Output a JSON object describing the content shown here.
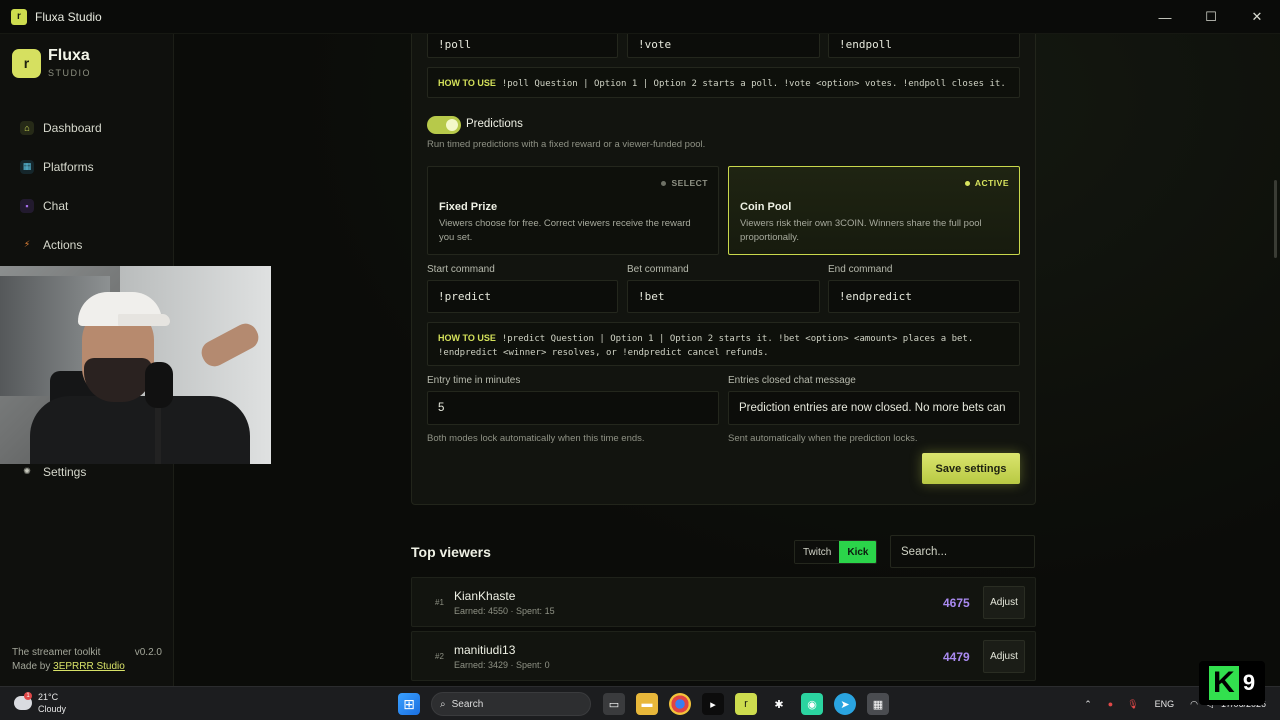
{
  "window": {
    "title": "Fluxa Studio",
    "controls": {
      "minimize": "—",
      "maximize": "☐",
      "close": "✕"
    }
  },
  "sidebar": {
    "brand_name": "Fluxa",
    "brand_sub": "STUDIO",
    "items": [
      {
        "label": "Dashboard",
        "icon": "home-icon",
        "color": "#d4e15a"
      },
      {
        "label": "Platforms",
        "icon": "grid-icon",
        "color": "#5ec8e8"
      },
      {
        "label": "Chat",
        "icon": "chat-icon",
        "color": "#a46de8"
      },
      {
        "label": "Actions",
        "icon": "bolt-icon",
        "color": "#f08a3a"
      }
    ],
    "settings_label": "Settings",
    "footer_tagline": "The streamer toolkit",
    "version": "v0.2.0",
    "made_by_prefix": "Made by ",
    "made_by_link": "3EPRRR Studio"
  },
  "polls": {
    "start": "!poll",
    "vote": "!vote",
    "end": "!endpoll",
    "howto_tag": "HOW TO USE",
    "howto_text": "!poll Question | Option 1 | Option 2 starts a poll. !vote <option> votes. !endpoll closes it."
  },
  "predictions": {
    "title": "Predictions",
    "enabled": true,
    "description": "Run timed predictions with a fixed reward or a viewer-funded pool.",
    "modes": [
      {
        "badge": "SELECT",
        "title": "Fixed Prize",
        "desc": "Viewers choose for free. Correct viewers receive the reward you set.",
        "active": false
      },
      {
        "badge": "ACTIVE",
        "title": "Coin Pool",
        "desc": "Viewers risk their own 3COIN. Winners share the full pool proportionally.",
        "active": true
      }
    ],
    "start_label": "Start command",
    "start_value": "!predict",
    "bet_label": "Bet command",
    "bet_value": "!bet",
    "end_label": "End command",
    "end_value": "!endpredict",
    "howto_tag": "HOW TO USE",
    "howto_text": "!predict Question | Option 1 | Option 2 starts it. !bet <option> <amount> places a bet. !endpredict <winner> resolves, or !endpredict cancel refunds.",
    "entry_label": "Entry time in minutes",
    "entry_value": "5",
    "entry_hint": "Both modes lock automatically when this time ends.",
    "closed_label": "Entries closed chat message",
    "closed_value": "Prediction entries are now closed. No more bets can",
    "closed_hint": "Sent automatically when the prediction locks.",
    "save_label": "Save settings"
  },
  "top_viewers": {
    "title": "Top viewers",
    "platforms": [
      "Twitch",
      "Kick"
    ],
    "active_platform": "Kick",
    "search_placeholder": "Search...",
    "rows": [
      {
        "rank": "#1",
        "name": "KianKhaste",
        "meta": "Earned: 4550 · Spent: 15",
        "score": "4675",
        "action": "Adjust"
      },
      {
        "rank": "#2",
        "name": "manitiudi13",
        "meta": "Earned: 3429 · Spent: 0",
        "score": "4479",
        "action": "Adjust"
      }
    ]
  },
  "taskbar": {
    "temp": "21°C",
    "weather": "Cloudy",
    "weather_badge": "1",
    "search": "Search",
    "lang": "ENG",
    "date": "17/06/2026"
  },
  "overlay": {
    "logo": "K",
    "number": "9"
  }
}
